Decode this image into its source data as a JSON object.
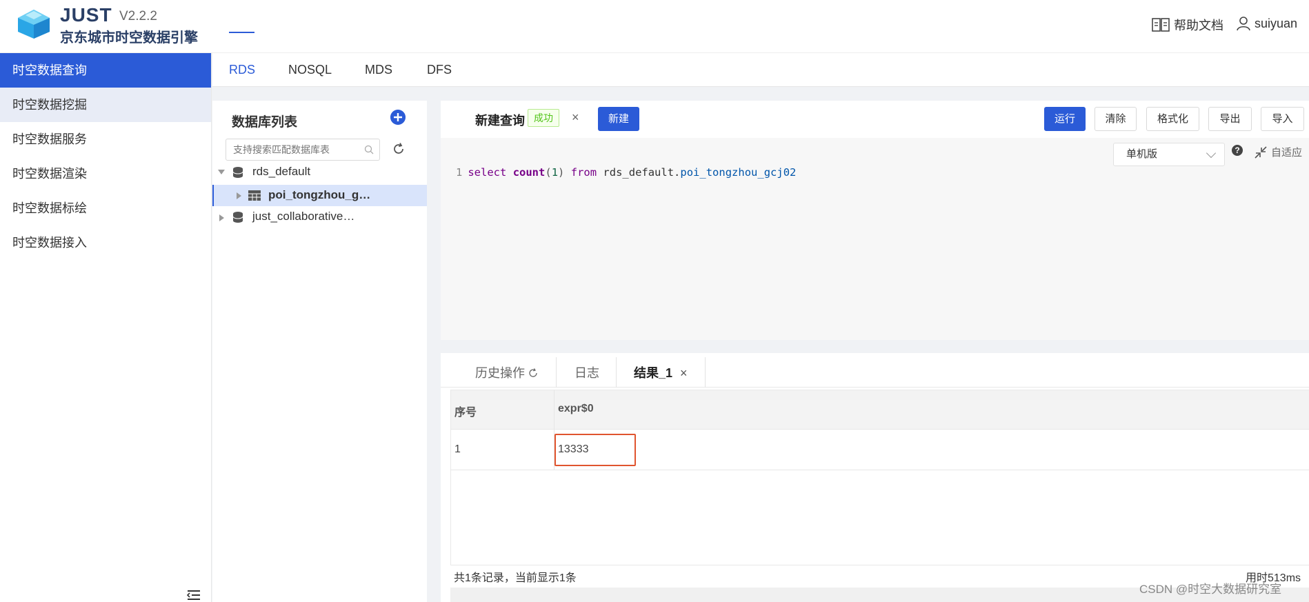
{
  "header": {
    "brand": "JUST",
    "version": "V2.2.2",
    "subtitle": "京东城市时空数据引擎",
    "help_label": "帮助文档",
    "username": "suiyuan"
  },
  "sidebar": {
    "items": [
      {
        "label": "时空数据查询"
      },
      {
        "label": "时空数据挖掘"
      },
      {
        "label": "时空数据服务"
      },
      {
        "label": "时空数据渲染"
      },
      {
        "label": "时空数据标绘"
      },
      {
        "label": "时空数据接入"
      }
    ]
  },
  "topnav": {
    "tabs": [
      {
        "label": "RDS"
      },
      {
        "label": "NOSQL"
      },
      {
        "label": "MDS"
      },
      {
        "label": "DFS"
      }
    ]
  },
  "db_panel": {
    "title": "数据库列表",
    "search_placeholder": "支持搜索匹配数据库表",
    "tree": [
      {
        "label": "rds_default"
      },
      {
        "label": "poi_tongzhou_g…"
      },
      {
        "label": "just_collaborative…"
      }
    ]
  },
  "editor": {
    "query_title": "新建查询",
    "status": "成功",
    "close": "×",
    "new_button": "新建",
    "buttons": {
      "run": "运行",
      "clear": "清除",
      "format": "格式化",
      "export": "导出",
      "import": "导入"
    },
    "mode": "单机版",
    "help_mark": "?",
    "fit_label": "自适应",
    "code": {
      "line_no": "1",
      "kw_select": "select",
      "fn_count": "count",
      "arg_open": "(",
      "arg_num": "1",
      "arg_close": ")",
      "kw_from": "from",
      "schema": "rds_default.",
      "table": "poi_tongzhou_gcj02"
    }
  },
  "results": {
    "tabs": {
      "history": "历史操作",
      "log": "日志",
      "result": "结果_1",
      "close": "×"
    },
    "columns": [
      "序号",
      "expr$0"
    ],
    "rows": [
      [
        "1",
        "13333"
      ]
    ],
    "summary": "共1条记录，当前显示1条",
    "elapsed": "用时513ms"
  },
  "watermark": "CSDN @时空大数据研究室",
  "colors": {
    "accent": "#2b5bd7",
    "success": "#52c41a",
    "highlight_box": "#e0542e"
  }
}
